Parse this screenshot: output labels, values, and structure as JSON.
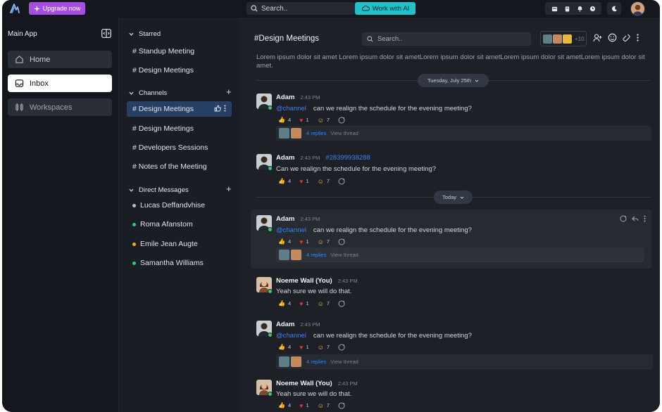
{
  "topbar": {
    "upgrade_label": "Upgrade now",
    "search_placeholder": "Search..",
    "work_ai_label": "Work with AI"
  },
  "mainbar": {
    "title": "Main App",
    "items": [
      {
        "label": "Home",
        "icon": "home-icon"
      },
      {
        "label": "Inbox",
        "icon": "inbox-icon"
      },
      {
        "label": "Workspaces",
        "icon": "workspaces-icon"
      }
    ]
  },
  "chanbar": {
    "starred_title": "Starred",
    "starred": [
      "# Standup Meeting",
      "# Design Meetings"
    ],
    "channels_title": "Channels",
    "channels": [
      "# Design Meetings",
      "# Design Meetings",
      "# Developers Sessions",
      "# Notes of the Meeting"
    ],
    "dm_title": "Direct Messages",
    "dms": [
      {
        "name": "Lucas Deffandvhise",
        "status_color": "#b8bcc4"
      },
      {
        "name": "Roma Afanstom",
        "status_color": "#2ecc71"
      },
      {
        "name": "Emile Jean Augte",
        "status_color": "#f5a623"
      },
      {
        "name": "Samantha Williams",
        "status_color": "#2ecc71"
      }
    ]
  },
  "main": {
    "channel_title": "#Design Meetings",
    "search_placeholder": "Search..",
    "members_more": "+10",
    "description": "Lorem ipsum dolor sit amet Lorem ipsum dolor sit ametLorem ipsum dolor sit ametLorem ipsum dolor sit ametLorem ipsum dolor sit amet.",
    "date1": "Tuesday, July 25th",
    "date2": "Today",
    "messages": [
      {
        "author": "Adam",
        "time": "2:43 PM",
        "mention": "@channel",
        "text": "can we realign the schedule for the evening meeting?",
        "r1": "4",
        "r2": "1",
        "r3": "7",
        "replies": "4 replies",
        "view": "View thread"
      },
      {
        "author": "Adam",
        "time": "2:43 PM",
        "tag": "#28399938288",
        "text": "Can we realign the schedule for the evening meeting?",
        "r1": "4",
        "r2": "1",
        "r3": "7"
      },
      {
        "author": "Adam",
        "time": "2:43 PM",
        "mention": "@channel",
        "text": "can we realign the schedule for the evening meeting?",
        "r1": "4",
        "r2": "1",
        "r3": "7",
        "replies": "4 replies",
        "view": "View thread"
      },
      {
        "author": "Noeme Wall (You)",
        "time": "2:43 PM",
        "text": "Yeah sure we will do that.",
        "r1": "4",
        "r2": "1",
        "r3": "7"
      },
      {
        "author": "Adam",
        "time": "2:43 PM",
        "mention": "@channel",
        "text": "can we realign the schedule for the evening meeting?",
        "r1": "4",
        "r2": "1",
        "r3": "7",
        "replies": "4 replies",
        "view": "View thread"
      },
      {
        "author": "Noeme Wall (You)",
        "time": "2:43 PM",
        "text": "Yeah sure we will do that.",
        "r1": "4",
        "r2": "1",
        "r3": "7"
      }
    ]
  },
  "colors": {
    "accent": "#3b82f6",
    "upgrade": "#a64ee4",
    "ai": "#1fc2c9",
    "active_channel": "#263f63"
  }
}
